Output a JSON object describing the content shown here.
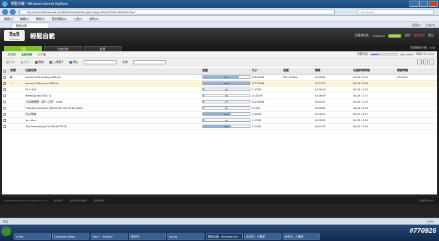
{
  "browser": {
    "window_title": "輕鬆自載 - Windows Internet Explorer",
    "url": "http://www.9x9download.com/EZDownload/index.jspx?lang=1&id=2072&v=ok&fetch=true",
    "search_placeholder": "Live Search",
    "menu": [
      "檔案(F)",
      "編輯(E)",
      "檢視(V)",
      "我的最愛(A)",
      "工具(T)",
      "說明(H)"
    ],
    "tab_label": "輕鬆自載",
    "tools": [
      "頁面(P)",
      "工具(O)"
    ],
    "status_text": "完成",
    "zoom": "100%"
  },
  "app": {
    "logo_text": "9x9",
    "logo_sub": "Download Engine",
    "title": "輕鬆自載",
    "header_right": {
      "device_label": "設備識別碼",
      "device_value": "7G080090",
      "badge": "ONLINE",
      "help": "說明",
      "warning": "服務到期",
      "logout": "登出"
    },
    "main_tabs": [
      "下載",
      "存儲空間",
      "設置"
    ],
    "active_tab": "下載",
    "user_info": "您還剩餘空間：3GB",
    "sub_tabs": [
      "未完成",
      "全部任務",
      "已下載"
    ],
    "active_sub_tab": "全部任務",
    "bandwidth_label": "總體速度",
    "bandwidth_value": "588.69KB/S",
    "bandwidth_extra": "剩餘231.13GB",
    "bandwidth_fill": 0.3,
    "toolbar": {
      "start": "開始",
      "pause": "暫停",
      "delete": "刪除",
      "upload": "上傳種子",
      "url_label": "網址",
      "name_label": "名稱"
    },
    "pager": {
      "page": "1"
    },
    "table": {
      "headers": [
        "狀態",
        "任務名稱",
        "進度",
        "大小",
        "速度",
        "剩餘",
        "任務新增時間",
        "剩餘時間"
      ],
      "rows": [
        {
          "status": "▶",
          "name": "ubuntu-8.04-desktop-i386.iso",
          "progress": 77,
          "size": "698.00MB",
          "speed": "597.12KB/s",
          "remain": "00:28:54",
          "added": "06-26 23:10",
          "eta": "00:04:50"
        },
        {
          "status": "✓",
          "name": "ubuntu-8.04-server-i386.iso",
          "progress": 100,
          "size": "577.21MB",
          "speed": "",
          "remain": "00:37:22",
          "added": "06-26 23:09",
          "eta": ""
        },
        {
          "status": "",
          "name": "SLK-038",
          "progress": 3,
          "size": "4.02GB",
          "speed": "",
          "remain": "04:30:03",
          "added": "06-26 13:20",
          "eta": ""
        },
        {
          "status": "",
          "name": "minitp2p-ran22(9.17)",
          "progress": 3,
          "size": "14.51GB",
          "speed": "",
          "remain": "03:36:09",
          "added": "06-26 12:17",
          "eta": ""
        },
        {
          "status": "",
          "name": "大盜賊集團（超人之家）.rmvb",
          "progress": 3,
          "size": "432.94MB",
          "speed": "",
          "remain": "00:51:57",
          "added": "06-26 11:13",
          "eta": ""
        },
        {
          "status": "",
          "name": "Fast and Furious 4 (2009) R5 Line DVDr-Salix1",
          "progress": 3,
          "size": "4.1GB",
          "speed": "",
          "remain": "00:05:52",
          "added": "06-25 15:43",
          "eta": ""
        },
        {
          "status": "",
          "name": "功夫熊貓",
          "progress": 60,
          "size": "4.35GB",
          "speed": "",
          "remain": "00:08:04",
          "added": "06-23 15:37",
          "eta": ""
        },
        {
          "status": "",
          "name": "Yes Man",
          "progress": 3,
          "size": "4.37GB",
          "speed": "",
          "remain": "00:05:32",
          "added": "06-23 15:34",
          "eta": ""
        },
        {
          "status": "",
          "name": "The International DVDR-MPTDVD",
          "progress": 60,
          "size": "4.37GB",
          "speed": "",
          "remain": "00:07:22",
          "added": "06-23 15:34",
          "eta": ""
        }
      ]
    },
    "footer": {
      "copyright": "@2008-2009 9X9Network, All Rights Reserved",
      "links": [
        "關於我們",
        "使用者條款與規章",
        "隱私權政策"
      ],
      "right": "下載設置軟件ZIP"
    }
  },
  "taskbar": {
    "items": [
      "#Thao",
      "Costenas Detalle",
      "New 7 - Beispiel",
      "研究所",
      "[quoc]",
      "輕鬆自載 - Windows Inte...",
      "未命名 - 小畫家",
      "未命名 - 小畫家"
    ],
    "clock": "#770926"
  }
}
